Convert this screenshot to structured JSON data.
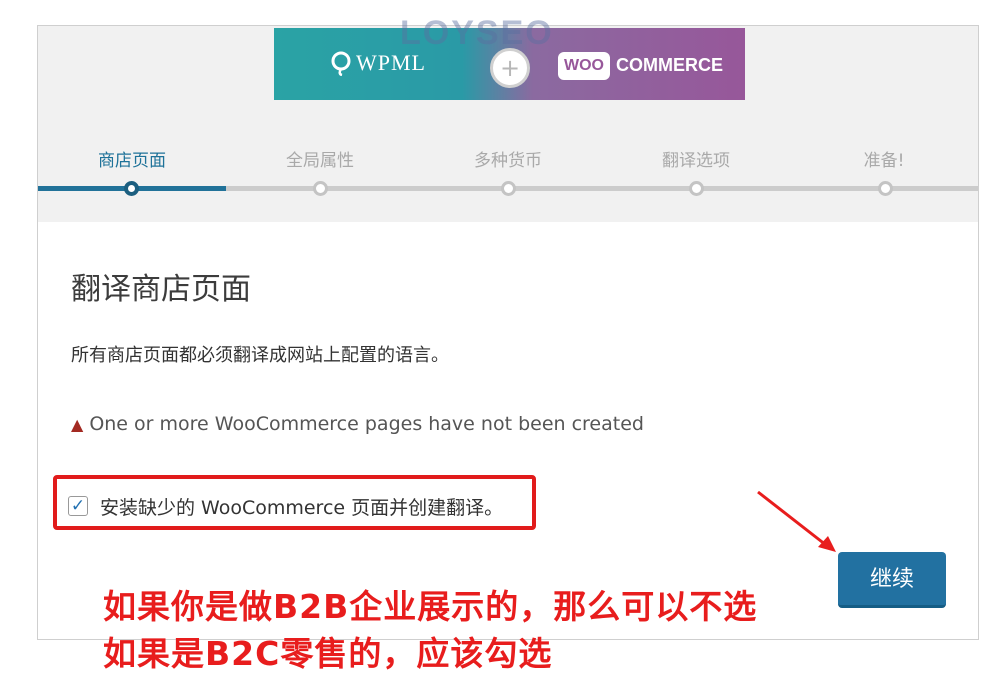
{
  "banner": {
    "wpml_label": "WPML",
    "plus_symbol": "+",
    "woo_label": "WOO",
    "commerce_label": "COMMERCE",
    "watermark": "LOYSEO",
    "colors": {
      "left": "#2aa3a5",
      "right": "#97579a"
    }
  },
  "wizard": {
    "steps": [
      {
        "label": "商店页面",
        "active": true
      },
      {
        "label": "全局属性",
        "active": false
      },
      {
        "label": "多种货币",
        "active": false
      },
      {
        "label": "翻译选项",
        "active": false
      },
      {
        "label": "准备!",
        "active": false
      }
    ]
  },
  "content": {
    "title": "翻译商店页面",
    "description": "所有商店页面都必须翻译成网站上配置的语言。",
    "warning_icon": "warning-icon",
    "warning_text": "One or more WooCommerce pages have not been created",
    "checkbox_label": "安装缺少的 WooCommerce 页面并创建翻译。",
    "checkbox_checked": true,
    "continue_button": "继续"
  },
  "annotation": {
    "line1": "如果你是做B2B企业展示的，那么可以不选",
    "line2": "如果是B2C零售的，应该勾选",
    "color": "#e81d1d"
  }
}
